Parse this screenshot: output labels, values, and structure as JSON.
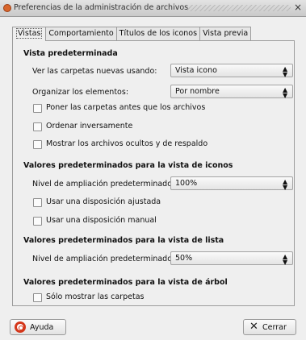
{
  "window": {
    "title": "Preferencias de la administración de archivos",
    "close_glyph": "×"
  },
  "tabs": [
    {
      "label": "Vistas",
      "active": true
    },
    {
      "label": "Comportamiento",
      "active": false
    },
    {
      "label": "Títulos de los iconos",
      "active": false
    },
    {
      "label": "Vista previa",
      "active": false
    }
  ],
  "default_view": {
    "title": "Vista predeterminada",
    "open_with_label": "Ver las carpetas nuevas usando:",
    "open_with_value": "Vista icono",
    "arrange_label": "Organizar los elementos:",
    "arrange_value": "Por nombre",
    "folders_first": "Poner las carpetas antes que los archivos",
    "reverse_order": "Ordenar inversamente",
    "show_hidden": "Mostrar los archivos ocultos y de respaldo"
  },
  "icon_view": {
    "title": "Valores predeterminados para la vista de iconos",
    "zoom_label": "Nivel de ampliación predeterminado:",
    "zoom_value": "100%",
    "compact_layout": "Usar una disposición ajustada",
    "manual_layout": "Usar una disposición manual"
  },
  "list_view": {
    "title": "Valores predeterminados para la vista de lista",
    "zoom_label": "Nivel de ampliación predeterminado:",
    "zoom_value": "50%"
  },
  "tree_view": {
    "title": "Valores predeterminados para la vista de árbol",
    "folders_only": "Sólo mostrar las carpetas"
  },
  "buttons": {
    "help": "Ayuda",
    "close": "Cerrar"
  },
  "combo_arrows": "▲▼",
  "colors": {
    "help_icon": "#d4361a",
    "app_icon": "#d8652b"
  }
}
